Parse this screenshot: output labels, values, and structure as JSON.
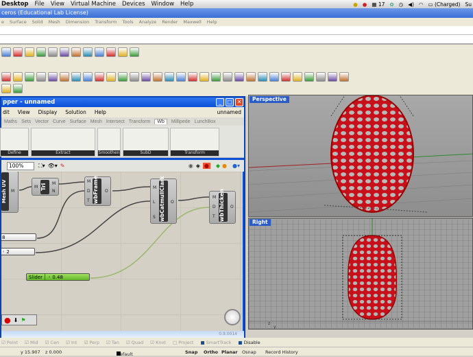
{
  "mac_menubar": {
    "items": [
      "Desktop",
      "File",
      "View",
      "Virtual Machine",
      "Devices",
      "Window",
      "Help"
    ],
    "date_badge": "17",
    "battery": "(Charged)",
    "user": "Su"
  },
  "rhino": {
    "title": "ceros (Educational Lab License)",
    "menu": [
      "e",
      "Surface",
      "Solid",
      "Mesh",
      "Dimension",
      "Transform",
      "Tools",
      "Analyze",
      "Render",
      "Maxwell",
      "Help"
    ]
  },
  "grasshopper": {
    "title": "pper - unnamed",
    "menu": [
      "dit",
      "View",
      "Display",
      "Solution",
      "Help"
    ],
    "doc_name": "unnamed",
    "tabs": [
      "Maths",
      "Sets",
      "Vector",
      "Curve",
      "Surface",
      "Mesh",
      "Intersect",
      "Transform",
      "Wb",
      "Millipede",
      "LunchBox"
    ],
    "active_tab": "Wb",
    "groups": [
      "Define",
      "Extract",
      "Smoothen",
      "SubD",
      "Transform"
    ],
    "zoom": "100%",
    "components": [
      {
        "name": "Tri",
        "inputs": [
          "M"
        ],
        "outputs": [
          "M",
          "N"
        ]
      },
      {
        "name": "wbFrame",
        "inputs": [
          "M",
          "D",
          "T"
        ],
        "outputs": [
          "O"
        ]
      },
      {
        "name": "wbCatmullClark",
        "inputs": [
          "M",
          "L",
          "S"
        ],
        "outputs": [
          "O"
        ]
      },
      {
        "name": "wbThicken",
        "inputs": [
          "M",
          "D",
          "T"
        ],
        "outputs": [
          "O"
        ]
      }
    ],
    "partial_component": {
      "name": "Mesh UV",
      "output": "M"
    },
    "number_inputs": [
      "8",
      "2"
    ],
    "slider": {
      "label": "Slider",
      "value": "0.48"
    },
    "version": "0.9.0014"
  },
  "viewports": [
    {
      "label": "Perspective"
    },
    {
      "label": "Right"
    }
  ],
  "osnap": [
    "Point",
    "Mid",
    "Cen",
    "Int",
    "Perp",
    "Tan",
    "Quad",
    "Knot",
    "Project",
    "SmartTrack",
    "Disable"
  ],
  "status": {
    "y": "y 15.907",
    "z": "z 0.000",
    "layer": "Default",
    "toggles": [
      "Snap",
      "Ortho",
      "Planar",
      "Osnap",
      "Record History"
    ]
  },
  "colors": {
    "egg": "#c8101a",
    "title_blue": "#0b4fd6",
    "slider": "#7ad03a"
  }
}
